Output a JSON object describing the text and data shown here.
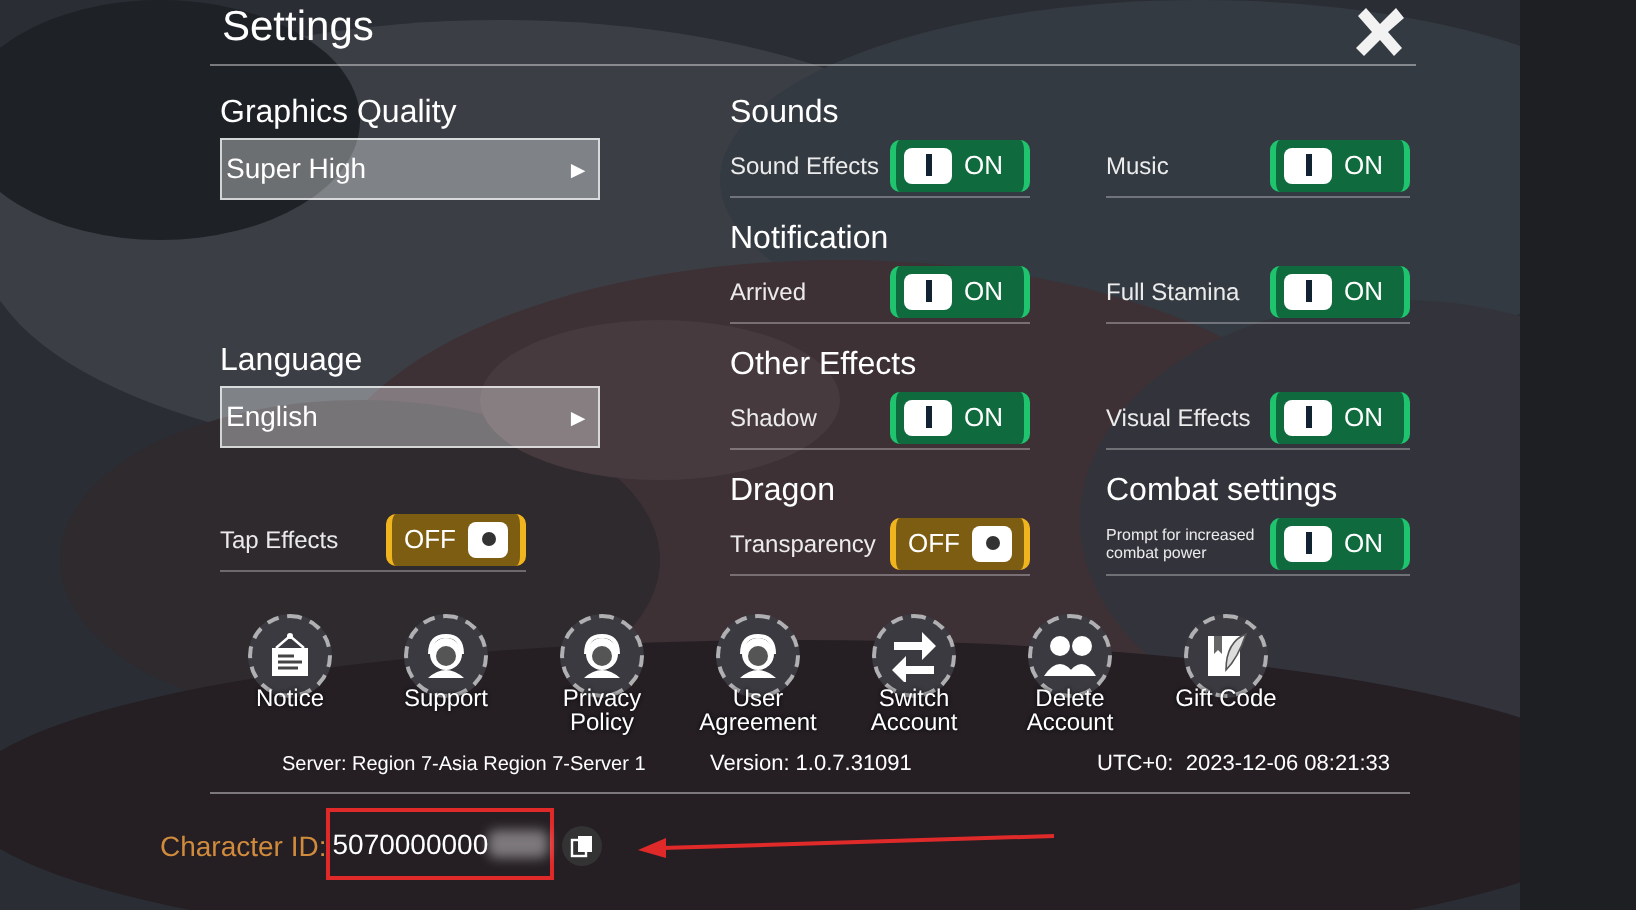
{
  "title": "Settings",
  "left": [
    {
      "heading": "Graphics Quality",
      "kind": "dropdown",
      "value": "Super High",
      "arrow": "►"
    },
    {
      "kind": "empty"
    },
    {
      "heading": "Language",
      "kind": "dropdown",
      "value": "English",
      "arrow": "►"
    },
    {
      "kind": "toggle",
      "label": "Tap Effects",
      "on": false,
      "state_text": "OFF"
    }
  ],
  "toggle_rows": [
    {
      "cells": [
        {
          "heading": "Sounds",
          "label": "Sound Effects",
          "on": true,
          "state_text": "ON"
        },
        {
          "label": "Music",
          "on": true,
          "state_text": "ON"
        }
      ]
    },
    {
      "cells": [
        {
          "heading": "Notification",
          "label": "Arrived",
          "on": true,
          "state_text": "ON"
        },
        {
          "label": "Full Stamina",
          "on": true,
          "state_text": "ON"
        }
      ]
    },
    {
      "cells": [
        {
          "heading": "Other Effects",
          "label": "Shadow",
          "on": true,
          "state_text": "ON"
        },
        {
          "label": "Visual Effects",
          "on": true,
          "state_text": "ON"
        }
      ]
    },
    {
      "cells": [
        {
          "heading": "Dragon",
          "label": "Transparency",
          "on": false,
          "state_text": "OFF"
        },
        {
          "heading": "Combat settings",
          "label": "Prompt for increased combat power",
          "on": true,
          "state_text": "ON"
        }
      ]
    }
  ],
  "actions": [
    {
      "kind": "notice",
      "label": "Notice"
    },
    {
      "kind": "headset",
      "label": "Support"
    },
    {
      "kind": "headset",
      "label": "Privacy Policy"
    },
    {
      "kind": "headset",
      "label": "User Agreement"
    },
    {
      "kind": "switch",
      "label": "Switch Account"
    },
    {
      "kind": "people",
      "label": "Delete Account"
    },
    {
      "kind": "gift",
      "label": "Gift Code"
    }
  ],
  "footer": {
    "server": "Server: Region 7-Asia Region 7-Server 1",
    "version": "Version: 1.0.7.31091",
    "time": "UTC+0:  2023-12-06 08:21:33"
  },
  "character_id": {
    "label": "Character ID:",
    "value": "5070000000"
  }
}
